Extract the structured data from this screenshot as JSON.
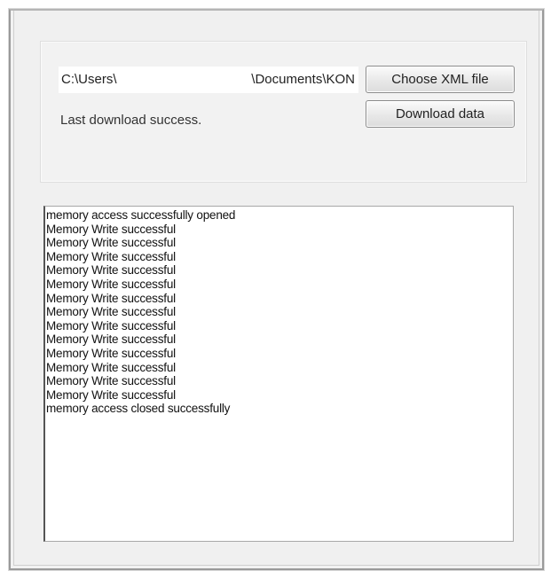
{
  "form": {
    "path_left": "C:\\Users\\",
    "path_right": "\\Documents\\KON",
    "choose_button": "Choose XML file",
    "download_button": "Download data",
    "status": "Last download success."
  },
  "log": {
    "lines": [
      "memory access successfully opened",
      "Memory Write successful",
      "Memory Write successful",
      "Memory Write successful",
      "Memory Write successful",
      "Memory Write successful",
      "Memory Write successful",
      "Memory Write successful",
      "Memory Write successful",
      "Memory Write successful",
      "Memory Write successful",
      "Memory Write successful",
      "Memory Write successful",
      "Memory Write successful",
      "memory access closed successfully"
    ]
  }
}
